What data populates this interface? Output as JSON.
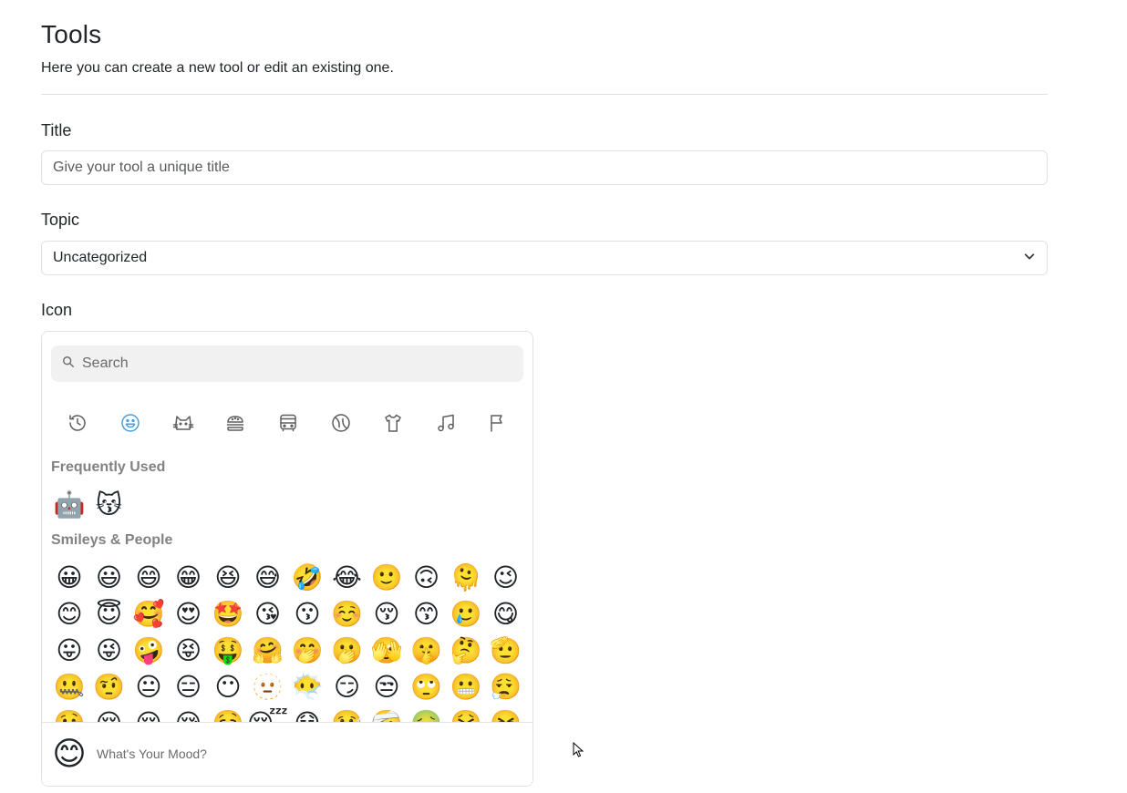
{
  "header": {
    "title": "Tools",
    "subtitle": "Here you can create a new tool or edit an existing one."
  },
  "form": {
    "title_label": "Title",
    "title_placeholder": "Give your tool a unique title",
    "title_value": "",
    "topic_label": "Topic",
    "topic_selected": "Uncategorized",
    "icon_label": "Icon"
  },
  "picker": {
    "search_placeholder": "Search",
    "categories": [
      {
        "icon": "clock-icon",
        "label": "Frequently Used"
      },
      {
        "icon": "smiley-icon",
        "label": "Smileys & People"
      },
      {
        "icon": "cat-icon",
        "label": "Animals & Nature"
      },
      {
        "icon": "burger-icon",
        "label": "Food & Drink"
      },
      {
        "icon": "bus-icon",
        "label": "Travel & Places"
      },
      {
        "icon": "ball-icon",
        "label": "Activities"
      },
      {
        "icon": "shirt-icon",
        "label": "Objects"
      },
      {
        "icon": "music-icon",
        "label": "Symbols"
      },
      {
        "icon": "flag-icon",
        "label": "Flags"
      }
    ],
    "active_category": "smiley-icon",
    "frequently_used_title": "Frequently Used",
    "frequently_used": [
      "🤖",
      "😽"
    ],
    "smileys_title": "Smileys & People",
    "smileys": [
      "😀",
      "😃",
      "😄",
      "😁",
      "😆",
      "😅",
      "🤣",
      "😂",
      "🙂",
      "🙃",
      "🫠",
      "😉",
      "😊",
      "😇",
      "🥰",
      "😍",
      "🤩",
      "😘",
      "😗",
      "☺️",
      "😚",
      "😙",
      "🥲",
      "😋",
      "😛",
      "😜",
      "🤪",
      "😝",
      "🤑",
      "🤗",
      "🤭",
      "🫢",
      "🫣",
      "🤫",
      "🤔",
      "🫡",
      "🤐",
      "🤨",
      "😐",
      "😑",
      "😶",
      "🫥",
      "😶‍🌫️",
      "😏",
      "😒",
      "🙄",
      "😬",
      "😮‍💨",
      "🤥",
      "😌",
      "😔",
      "😪",
      "🤤",
      "😴",
      "😷",
      "🤒",
      "🤕",
      "🤢",
      "🤮",
      "🤧"
    ],
    "preview_emoji": "😊",
    "preview_text": "What's Your Mood?"
  }
}
